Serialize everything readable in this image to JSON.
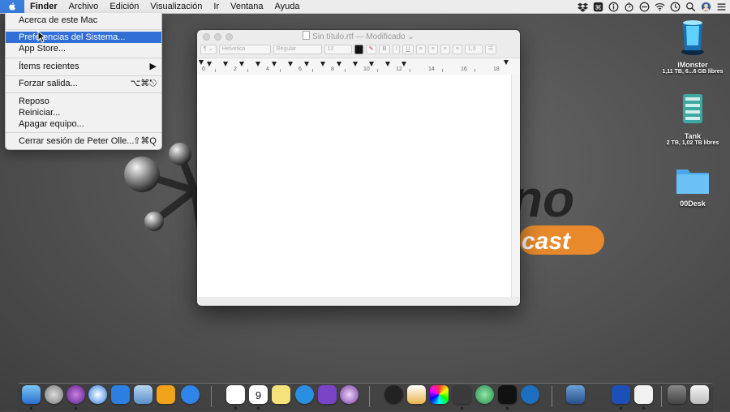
{
  "menubar": {
    "apple_icon": "apple-logo",
    "items": [
      "Finder",
      "Archivo",
      "Edición",
      "Visualización",
      "Ir",
      "Ventana",
      "Ayuda"
    ],
    "status_icons": [
      "dropbox-icon",
      "command-icon",
      "info-icon",
      "stopwatch-icon",
      "no-entry-icon",
      "wifi-icon",
      "clock-icon",
      "search-icon",
      "avatar-icon",
      "list-icon"
    ]
  },
  "apple_menu": {
    "items": [
      {
        "label": "Acerca de este Mac",
        "shortcut": ""
      },
      {
        "label": "Preferencias del Sistema...",
        "shortcut": ""
      },
      {
        "label": "App Store...",
        "shortcut": ""
      },
      {
        "label": "Ítems recientes",
        "shortcut": "▶"
      },
      {
        "label": "Forzar salida...",
        "shortcut": "⌥⌘⎋"
      },
      {
        "label": "Reposo",
        "shortcut": ""
      },
      {
        "label": "Reiniciar...",
        "shortcut": ""
      },
      {
        "label": "Apagar equipo...",
        "shortcut": ""
      },
      {
        "label": "Cerrar sesión de Peter Olle...",
        "shortcut": "⇧⌘Q"
      }
    ],
    "selected_index": 1
  },
  "desktop_logo": {
    "text_big": "no",
    "text_small": "cast"
  },
  "textedit": {
    "title": "Sin título.rtf",
    "title_state": "Modificado",
    "toolbar": {
      "paragraph": "¶",
      "font": "Helvetica",
      "style": "Regular",
      "size": "12",
      "bold": "B",
      "italic": "I",
      "underline": "U",
      "spacing": "1,0"
    },
    "ruler_numbers": [
      "0",
      "2",
      "4",
      "6",
      "8",
      "10",
      "12",
      "14",
      "16",
      "18"
    ]
  },
  "desktop_icons": [
    {
      "name": "iMonster",
      "sub": "1,11 TB, 6...6 GB libres",
      "icon": "hard-drive-blue-icon"
    },
    {
      "name": "Tank",
      "sub": "2 TB, 1,02 TB libres",
      "icon": "hard-drive-green-icon"
    },
    {
      "name": "00Desk",
      "sub": "",
      "icon": "folder-icon"
    }
  ],
  "dock": {
    "apps": [
      "finder",
      "launchpad",
      "safari-alt",
      "safari",
      "paperplane",
      "preview",
      "soundboard",
      "messages",
      "slack",
      "calendar",
      "notes",
      "mplus",
      "omnifocus",
      "tor",
      "git",
      "snippets",
      "colors",
      "sublime",
      "atom",
      "terminal",
      "tower",
      "xcode-tools",
      "keynote",
      "photos",
      "textedit",
      "drive",
      "trash"
    ],
    "calendar_day": "9",
    "calendar_month": "JUL",
    "accent_color": "#2f6fd6"
  }
}
